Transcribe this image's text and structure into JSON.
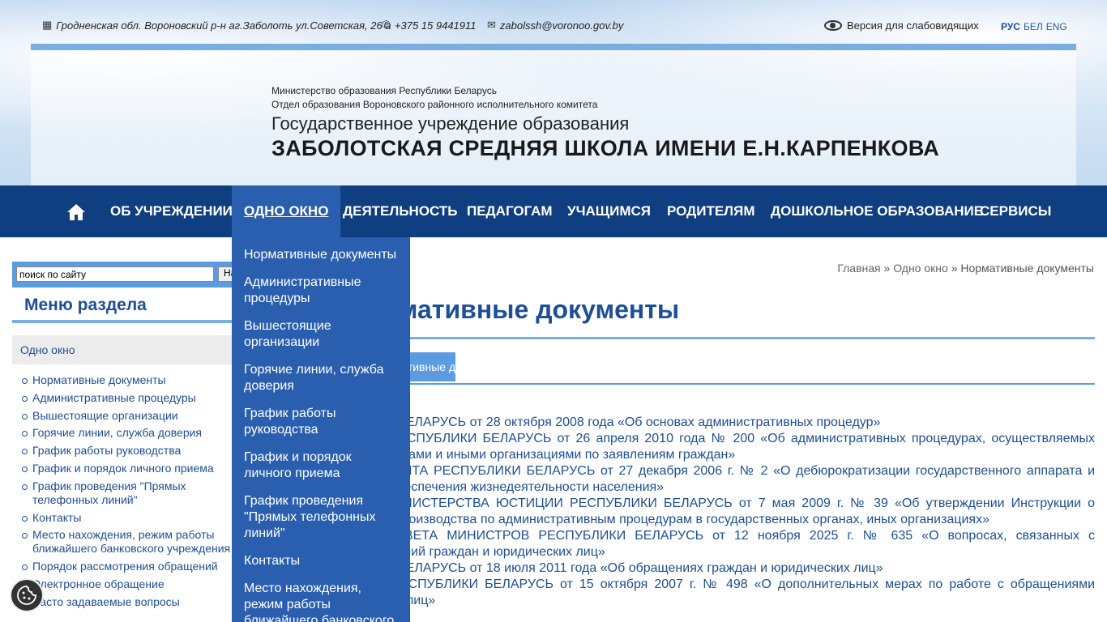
{
  "topbar": {
    "address": "Гродненская обл. Вороновский р-н аг.Заболоть ул.Советская, 26 а",
    "phone": "+375 15 9441911",
    "email": "zabolssh@voronoo.gov.by",
    "accessibility": "Версия для слабовидящих",
    "languages": [
      "РУС",
      "БЕЛ",
      "ENG"
    ],
    "active_language": "РУС",
    "icons": [
      "building-icon",
      "phone-icon",
      "mail-icon",
      "eye-icon"
    ]
  },
  "header": {
    "ministry": "Министерство образования Республики Беларусь",
    "department": "Отдел образования Вороновского районного исполнительного комитета",
    "institution_type": "Государственное учреждение образования",
    "school_name": "ЗАБОЛОТСКАЯ СРЕДНЯЯ ШКОЛА ИМЕНИ Е.Н.КАРПЕНКОВА"
  },
  "nav": {
    "items": [
      "ОБ УЧРЕЖДЕНИИ",
      "ОДНО ОКНО",
      "ДЕЯТЕЛЬНОСТЬ",
      "ПЕДАГОГАМ",
      "УЧАЩИМСЯ",
      "РОДИТЕЛЯМ",
      "ДОШКОЛЬНОЕ ОБРАЗОВАНИЕ",
      "СЕРВИСЫ"
    ],
    "active": "ОДНО ОКНО"
  },
  "dropdown": {
    "items": [
      "Нормативные документы",
      "Административные процедуры",
      "Вышестоящие организации",
      "Горячие линии, служба доверия",
      "График работы руководства",
      "График и порядок личного приема",
      "График проведения \"Прямых телефонных линий\"",
      "Контакты",
      "Место нахождения, режим работы ближайшего банковского учреждения"
    ]
  },
  "search": {
    "value": "поиск по сайту",
    "button": "Найти"
  },
  "sidebar": {
    "title": "Меню раздела",
    "section": "Одно окно",
    "items": [
      "Нормативные документы",
      "Административные процедуры",
      "Вышестоящие организации",
      "Горячие линии, служба доверия",
      "График работы руководства",
      "График и порядок личного приема",
      "График проведения \"Прямых телефонных линий\"",
      "Контакты",
      "Место нахождения, режим работы ближайшего банковского учреждения",
      "Порядок рассмотрения обращений",
      "Электронное обращение",
      "Часто задаваемые вопросы"
    ]
  },
  "breadcrumb": {
    "home": "Главная",
    "section": "Одно окно",
    "current": "Нормативные документы",
    "separator": "»"
  },
  "main": {
    "title": "Нормативные документы",
    "tab": "Нормативные документы",
    "documents": [
      "ЗАКОН РЕСПУБЛИКИ БЕЛАРУСЬ от 28 октября 2008 года «Об основах административных процедур»",
      "УКАЗ ПРЕЗИДЕНТА РЕСПУБЛИКИ БЕЛАРУСЬ от 26 апреля 2010 года № 200 «Об административных процедурах, осуществляемых государственными органами и иными организациями по заявлениям граждан»",
      "ДИРЕКТИВА ПРЕЗИДЕНТА РЕСПУБЛИКИ БЕЛАРУСЬ от 27 декабря 2006 г. № 2 «О дебюрократизации государственного аппарата и повышении качества обеспечения жизнедеятельности населения»",
      "ПОСТАНОВЛЕНИЕ МИНИСТЕРСТВА ЮСТИЦИИ РЕСПУБЛИКИ БЕЛАРУСЬ от 7 мая 2009 г. № 39 «Об утверждении Инструкции о порядке ведения делопроизводства по административным процедурам в государственных органах, иных организациях»",
      "ПОСТАНОВЛЕНИЕ СОВЕТА МИНИСТРОВ РЕСПУБЛИКИ БЕЛАРУСЬ от 12 ноября 2025 г. № 635 «О вопросах, связанных с рассмотрением обращений граждан и юридических лиц»",
      "ЗАКОН РЕСПУБЛИКИ БЕЛАРУСЬ от 18 июля 2011 года «Об обращениях граждан и юридических лиц»",
      "УКАЗ ПРЕЗИДЕНТА РЕСПУБЛИКИ БЕЛАРУСЬ от 15 октября 2007 г. № 498 «О дополнительных мерах по работе с обращениями граждан и юридических лиц»"
    ]
  },
  "colors": {
    "nav_bg": "#0f3f80",
    "nav_active": "#2a5fb0",
    "link": "#1d4f96",
    "accent_line": "#7aaee0"
  }
}
